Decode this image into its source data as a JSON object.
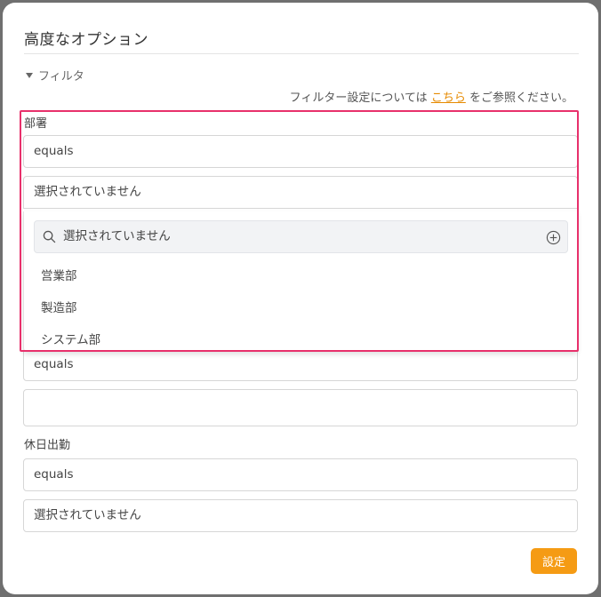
{
  "dialog": {
    "title": "高度なオプション",
    "filter_toggle": "フィルタ",
    "note": {
      "prefix": "フィルター設定については",
      "link": "こちら",
      "suffix": "をご参照ください。"
    }
  },
  "department": {
    "label": "部署",
    "operator": "equals",
    "value_placeholder": "選択されていません",
    "dropdown": {
      "search_placeholder": "選択されていません",
      "options": [
        "営業部",
        "製造部",
        "システム部"
      ]
    }
  },
  "second_field": {
    "operator": "equals",
    "value": ""
  },
  "holiday_work": {
    "label": "休日出勤",
    "operator": "equals",
    "value_placeholder": "選択されていません"
  },
  "footer": {
    "set_button": "設定"
  },
  "colors": {
    "accent": "#f59b14",
    "link": "#e68a00",
    "highlight": "#e8306b"
  }
}
